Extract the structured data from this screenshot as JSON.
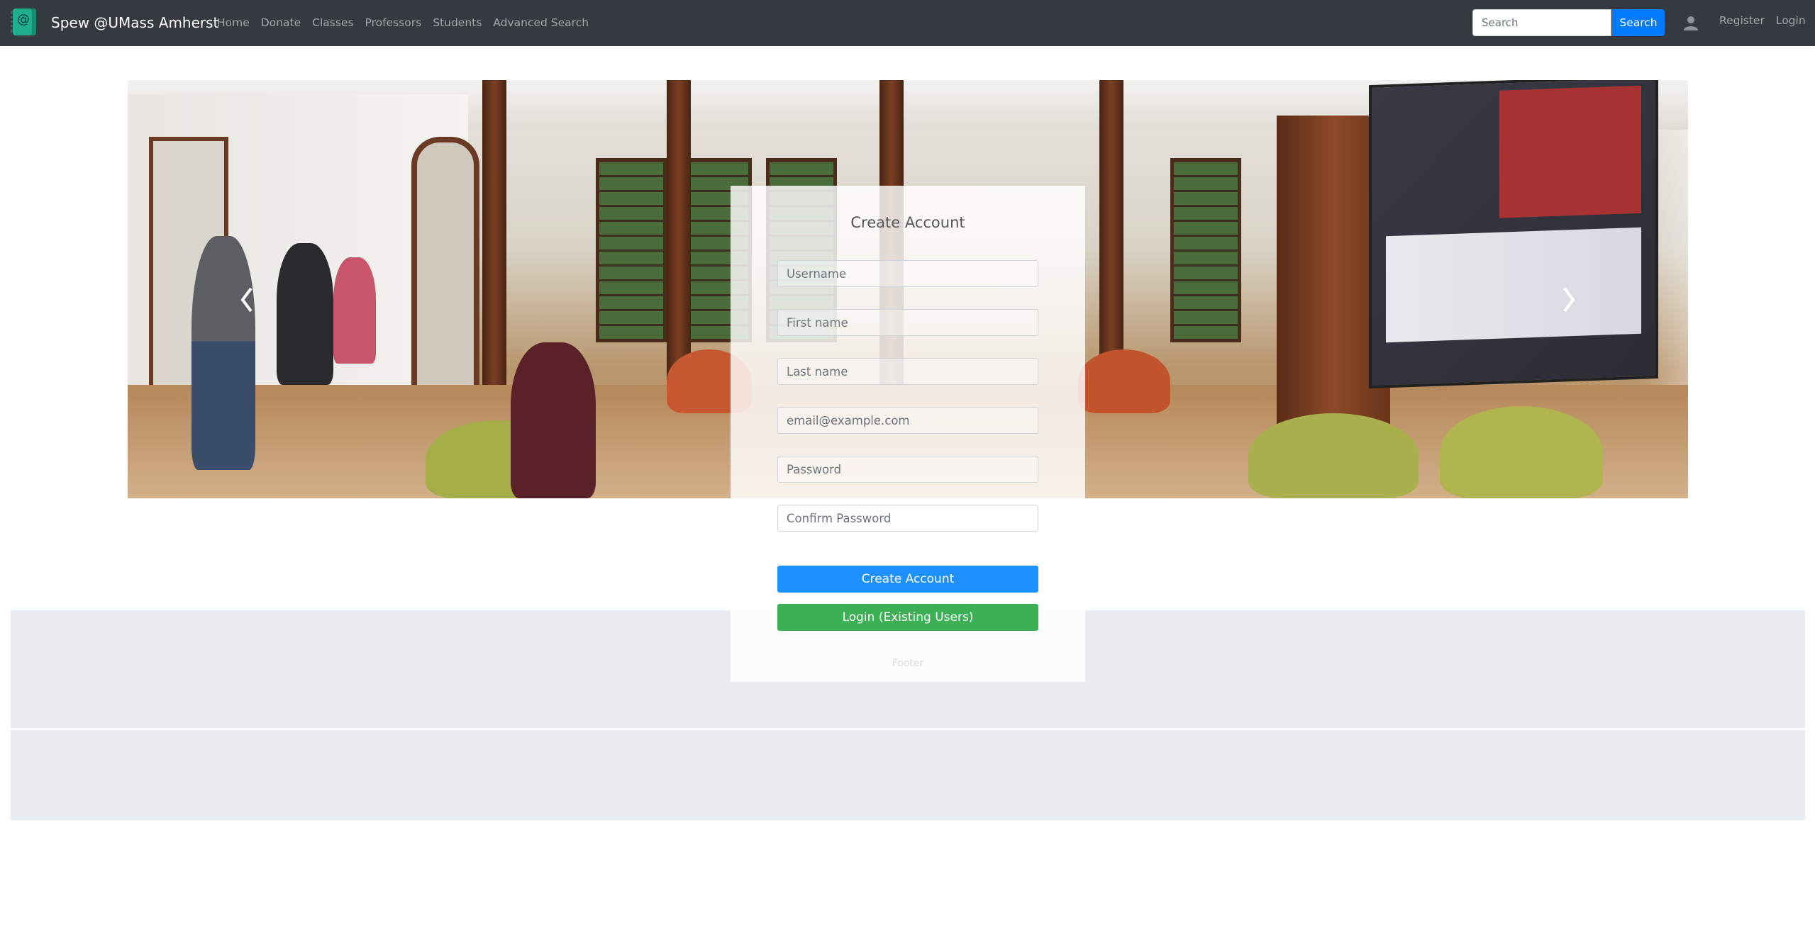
{
  "navbar": {
    "brand": "Spew @UMass Amherst",
    "links": [
      "Home",
      "Donate",
      "Classes",
      "Professors",
      "Students",
      "Advanced Search"
    ],
    "search_placeholder": "Search",
    "search_button": "Search",
    "register": "Register",
    "login": "Login"
  },
  "form": {
    "title": "Create Account",
    "username_placeholder": "Username",
    "firstname_placeholder": "First name",
    "lastname_placeholder": "Last name",
    "email_placeholder": "email@example.com",
    "password_placeholder": "Password",
    "confirm_placeholder": "Confirm Password",
    "create_button": "Create Account",
    "login_button": "Login (Existing Users)"
  },
  "footer": {
    "text": "Footer"
  },
  "colors": {
    "navbar_bg": "#343a40",
    "primary": "#007bff",
    "success": "#3cb054",
    "footer_bg": "#e9ecef"
  }
}
